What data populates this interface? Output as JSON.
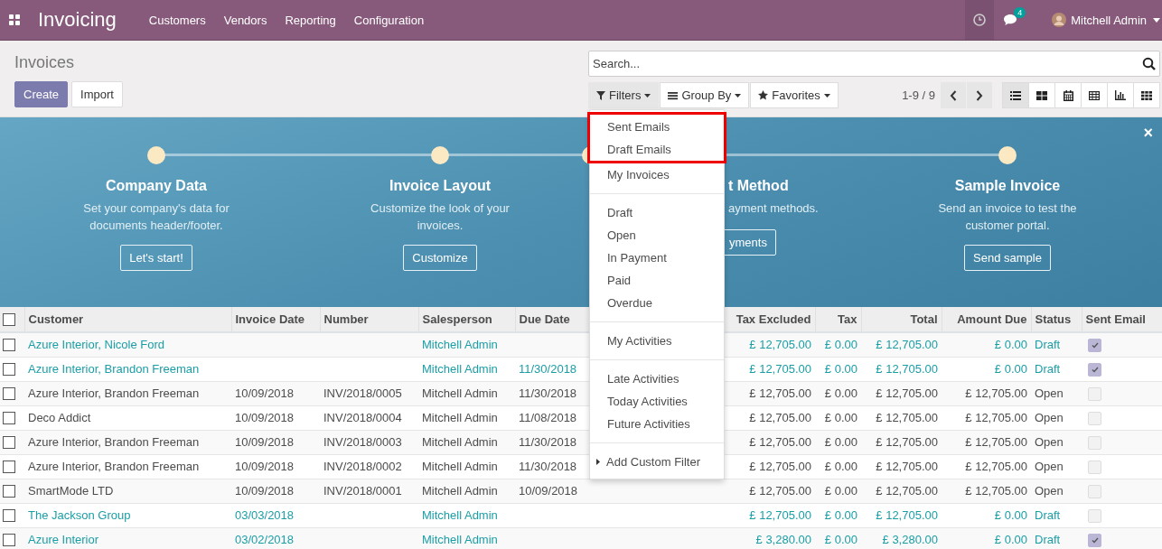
{
  "navbar": {
    "app_name": "Invoicing",
    "menu": [
      "Customers",
      "Vendors",
      "Reporting",
      "Configuration"
    ],
    "chat_badge": "4",
    "user": "Mitchell Admin"
  },
  "control_panel": {
    "breadcrumb": "Invoices",
    "search": {
      "placeholder": "Search..."
    },
    "buttons": [
      {
        "label": "Create",
        "kind": "primary"
      },
      {
        "label": "Import",
        "kind": "secondary"
      }
    ],
    "search_buttons": [
      {
        "label": "Filters",
        "expanded": true
      },
      {
        "label": "Group By",
        "expanded": false
      },
      {
        "label": "Favorites",
        "expanded": false
      }
    ],
    "pager": "1-9 / 9",
    "views": [
      {
        "selected": true
      },
      {
        "selected": false
      },
      {
        "selected": false
      },
      {
        "selected": false
      },
      {
        "selected": false
      },
      {
        "selected": false
      }
    ]
  },
  "filters_menu": {
    "groups": [
      [
        {
          "label": "Sent Emails",
          "highlighted": true
        },
        {
          "label": "Draft Emails",
          "highlighted": true
        },
        {
          "label": "My Invoices",
          "highlighted": false
        }
      ],
      [
        {
          "label": "Draft",
          "highlighted": false
        },
        {
          "label": "Open",
          "highlighted": false
        },
        {
          "label": "In Payment",
          "highlighted": false
        },
        {
          "label": "Paid",
          "highlighted": false
        },
        {
          "label": "Overdue",
          "highlighted": false
        }
      ],
      [
        {
          "label": "My Activities",
          "highlighted": false
        }
      ],
      [
        {
          "label": "Late Activities",
          "highlighted": false
        },
        {
          "label": "Today Activities",
          "highlighted": false
        },
        {
          "label": "Future Activities",
          "highlighted": false
        }
      ]
    ],
    "custom_filter": "Add Custom Filter"
  },
  "onboarding": {
    "close": "×",
    "steps": [
      {
        "kind": "full",
        "title": "Company Data",
        "description": "Set your company's data for documents header/footer.",
        "button": "Let's start!"
      },
      {
        "kind": "full",
        "title": "Invoice Layout",
        "description": "Customize the look of your invoices.",
        "button": "Customize"
      },
      {
        "kind": "partial",
        "title": "t Method",
        "description": "ayment methods.",
        "button": "yments"
      },
      {
        "kind": "full",
        "title": "Sample Invoice",
        "description": "Send an invoice to test the customer portal.",
        "button": "Send sample"
      }
    ]
  },
  "table": {
    "all_selected": false,
    "columns": [
      "Customer",
      "Invoice Date",
      "Number",
      "Salesperson",
      "Due Date",
      "Tax Excluded",
      "Tax",
      "Total",
      "Amount Due",
      "Status",
      "Sent Email"
    ],
    "rows": [
      {
        "selected": false,
        "kind": "draft",
        "customer": "Azure Interior, Nicole Ford",
        "salesperson": "Mitchell Admin",
        "tax_excluded": "£ 12,705.00",
        "tax": "£ 0.00",
        "total": "£ 12,705.00",
        "amount_due": "£ 0.00",
        "status": "Draft",
        "sent_email": true
      },
      {
        "selected": false,
        "kind": "draft",
        "customer": "Azure Interior, Brandon Freeman",
        "salesperson": "Mitchell Admin",
        "due_date": "11/30/2018",
        "tax_excluded": "£ 12,705.00",
        "tax": "£ 0.00",
        "total": "£ 12,705.00",
        "amount_due": "£ 0.00",
        "status": "Draft",
        "sent_email": true
      },
      {
        "selected": false,
        "kind": "open",
        "customer": "Azure Interior, Brandon Freeman",
        "invoice_date": "10/09/2018",
        "number": "INV/2018/0005",
        "salesperson": "Mitchell Admin",
        "due_date": "11/30/2018",
        "tax_excluded": "£ 12,705.00",
        "tax": "£ 0.00",
        "total": "£ 12,705.00",
        "amount_due": "£ 12,705.00",
        "status": "Open",
        "sent_email": false
      },
      {
        "selected": false,
        "kind": "open",
        "customer": "Deco Addict",
        "invoice_date": "10/09/2018",
        "number": "INV/2018/0004",
        "salesperson": "Mitchell Admin",
        "due_date": "11/08/2018",
        "tax_excluded": "£ 12,705.00",
        "tax": "£ 0.00",
        "total": "£ 12,705.00",
        "amount_due": "£ 12,705.00",
        "status": "Open",
        "sent_email": false
      },
      {
        "selected": false,
        "kind": "open",
        "customer": "Azure Interior, Brandon Freeman",
        "invoice_date": "10/09/2018",
        "number": "INV/2018/0003",
        "salesperson": "Mitchell Admin",
        "due_date": "11/30/2018",
        "tax_excluded": "£ 12,705.00",
        "tax": "£ 0.00",
        "total": "£ 12,705.00",
        "amount_due": "£ 12,705.00",
        "status": "Open",
        "sent_email": false
      },
      {
        "selected": false,
        "kind": "open",
        "customer": "Azure Interior, Brandon Freeman",
        "invoice_date": "10/09/2018",
        "number": "INV/2018/0002",
        "salesperson": "Mitchell Admin",
        "due_date": "11/30/2018",
        "tax_excluded": "£ 12,705.00",
        "tax": "£ 0.00",
        "total": "£ 12,705.00",
        "amount_due": "£ 12,705.00",
        "status": "Open",
        "sent_email": false
      },
      {
        "selected": false,
        "kind": "open",
        "customer": "SmartMode LTD",
        "invoice_date": "10/09/2018",
        "number": "INV/2018/0001",
        "salesperson": "Mitchell Admin",
        "due_date": "10/09/2018",
        "tax_excluded": "£ 12,705.00",
        "tax": "£ 0.00",
        "total": "£ 12,705.00",
        "amount_due": "£ 12,705.00",
        "status": "Open",
        "sent_email": false
      },
      {
        "selected": false,
        "kind": "draft",
        "customer": "The Jackson Group",
        "invoice_date": "03/03/2018",
        "salesperson": "Mitchell Admin",
        "tax_excluded": "£ 12,705.00",
        "tax": "£ 0.00",
        "total": "£ 12,705.00",
        "amount_due": "£ 0.00",
        "status": "Draft",
        "sent_email": false
      },
      {
        "selected": false,
        "kind": "draft",
        "customer": "Azure Interior",
        "invoice_date": "03/02/2018",
        "salesperson": "Mitchell Admin",
        "tax_excluded": "£ 3,280.00",
        "tax": "£ 0.00",
        "total": "£ 3,280.00",
        "amount_due": "£ 0.00",
        "status": "Draft",
        "sent_email": true
      }
    ]
  }
}
